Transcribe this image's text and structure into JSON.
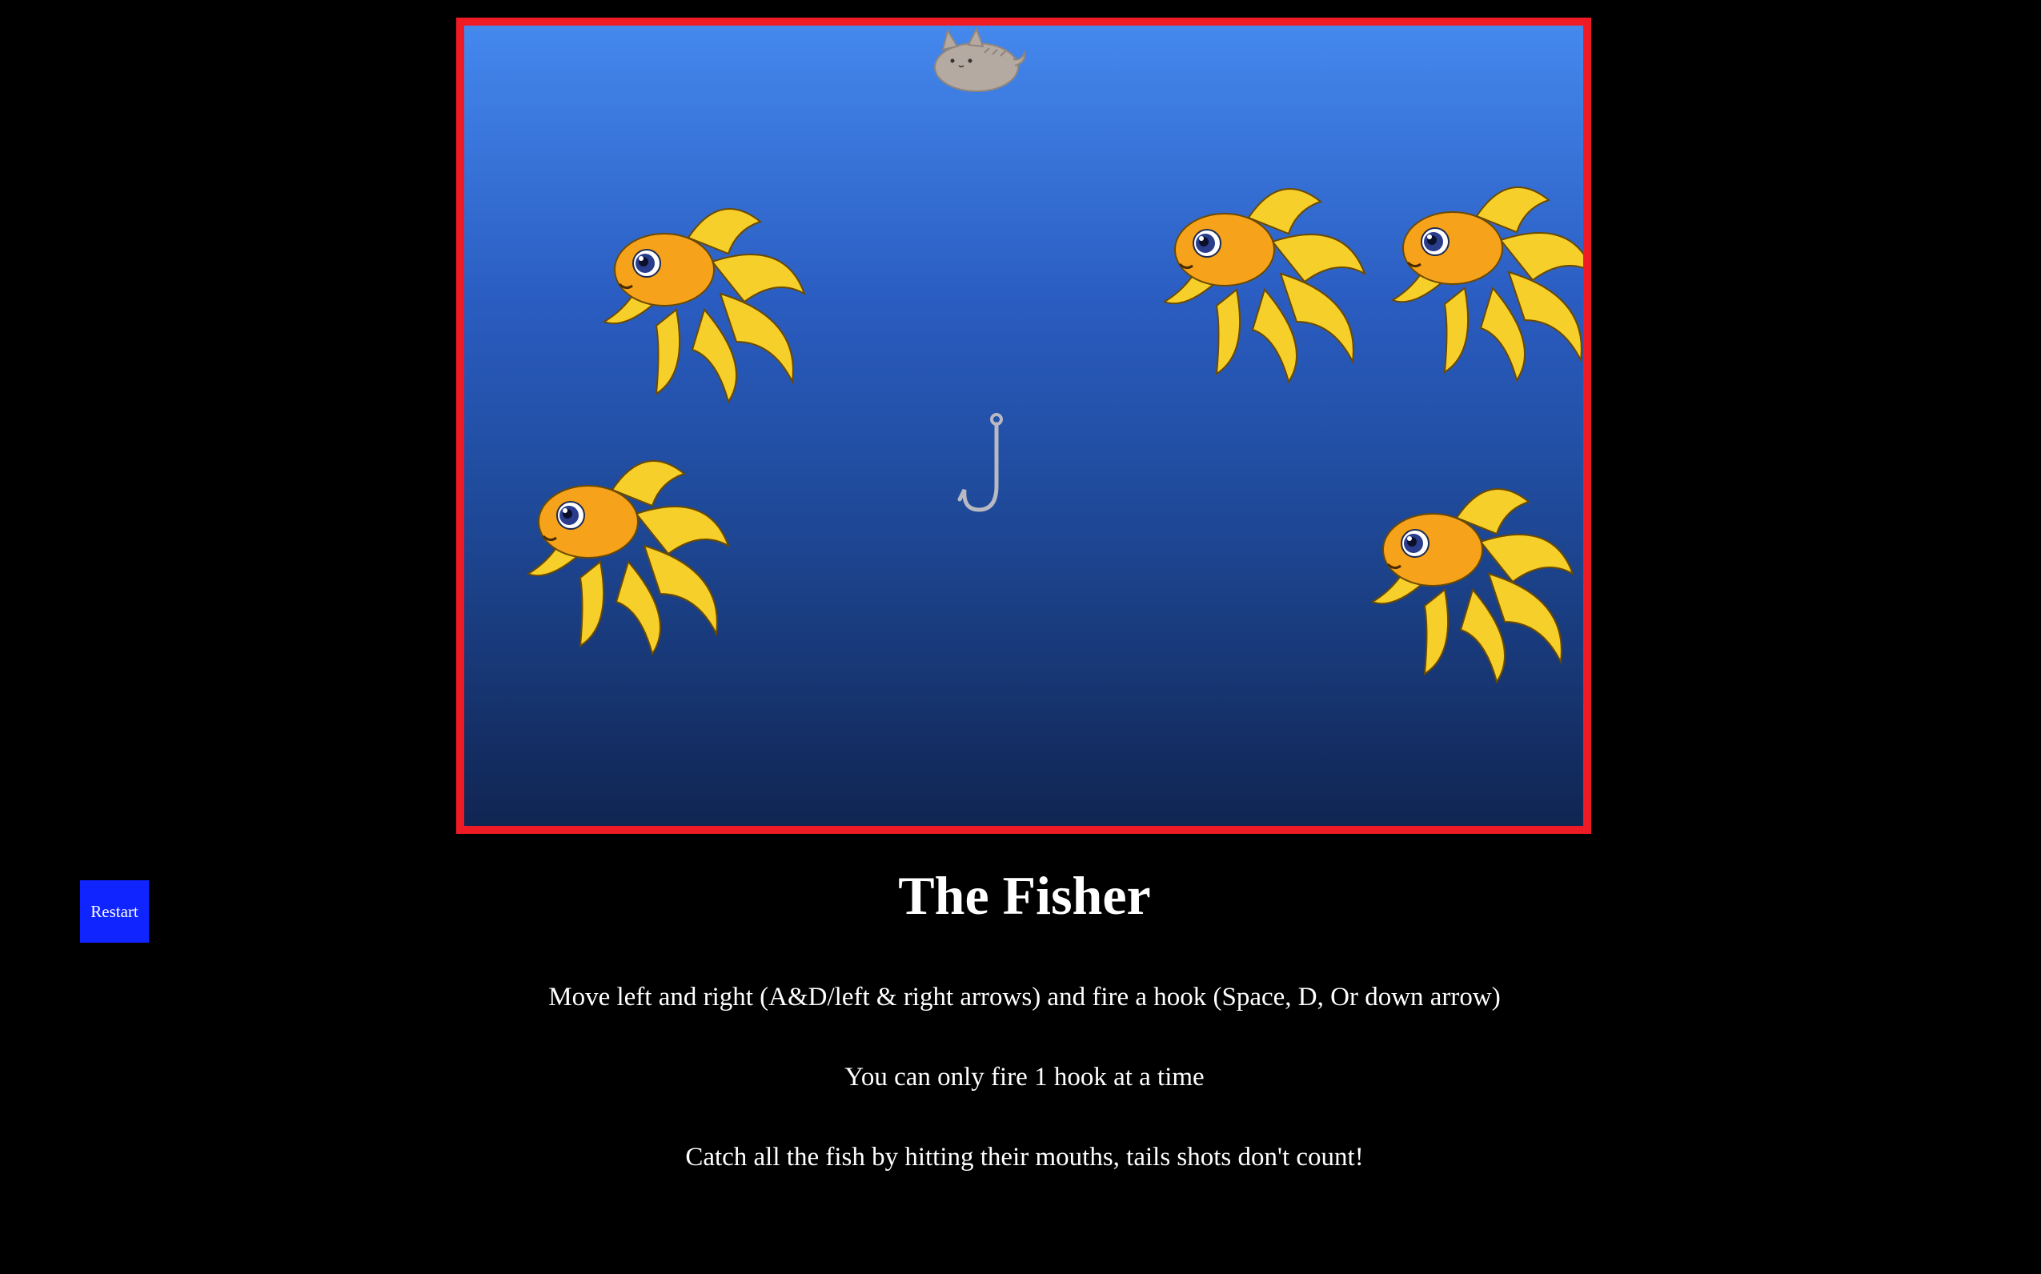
{
  "game": {
    "title": "The Fisher",
    "instructions": [
      "Move left and right (A&D/left & right arrows) and fire a hook (Space, D, Or down arrow)",
      "You can only fire 1 hook at a time",
      "Catch all the fish by hitting their mouths, tails shots don't count!"
    ],
    "restart_label": "Restart",
    "colors": {
      "frame_border": "#ef1b24",
      "water_top": "#4488ee",
      "water_bottom": "#102552",
      "restart_button": "#1024ff",
      "fish_body": "#f7a21b",
      "fish_tail": "#f7cf2a"
    },
    "sprites": {
      "player": "pusheen-cat-icon",
      "hook": "fishing-hook-icon",
      "fish": "goldfish-icon"
    },
    "fish_count": 5
  }
}
